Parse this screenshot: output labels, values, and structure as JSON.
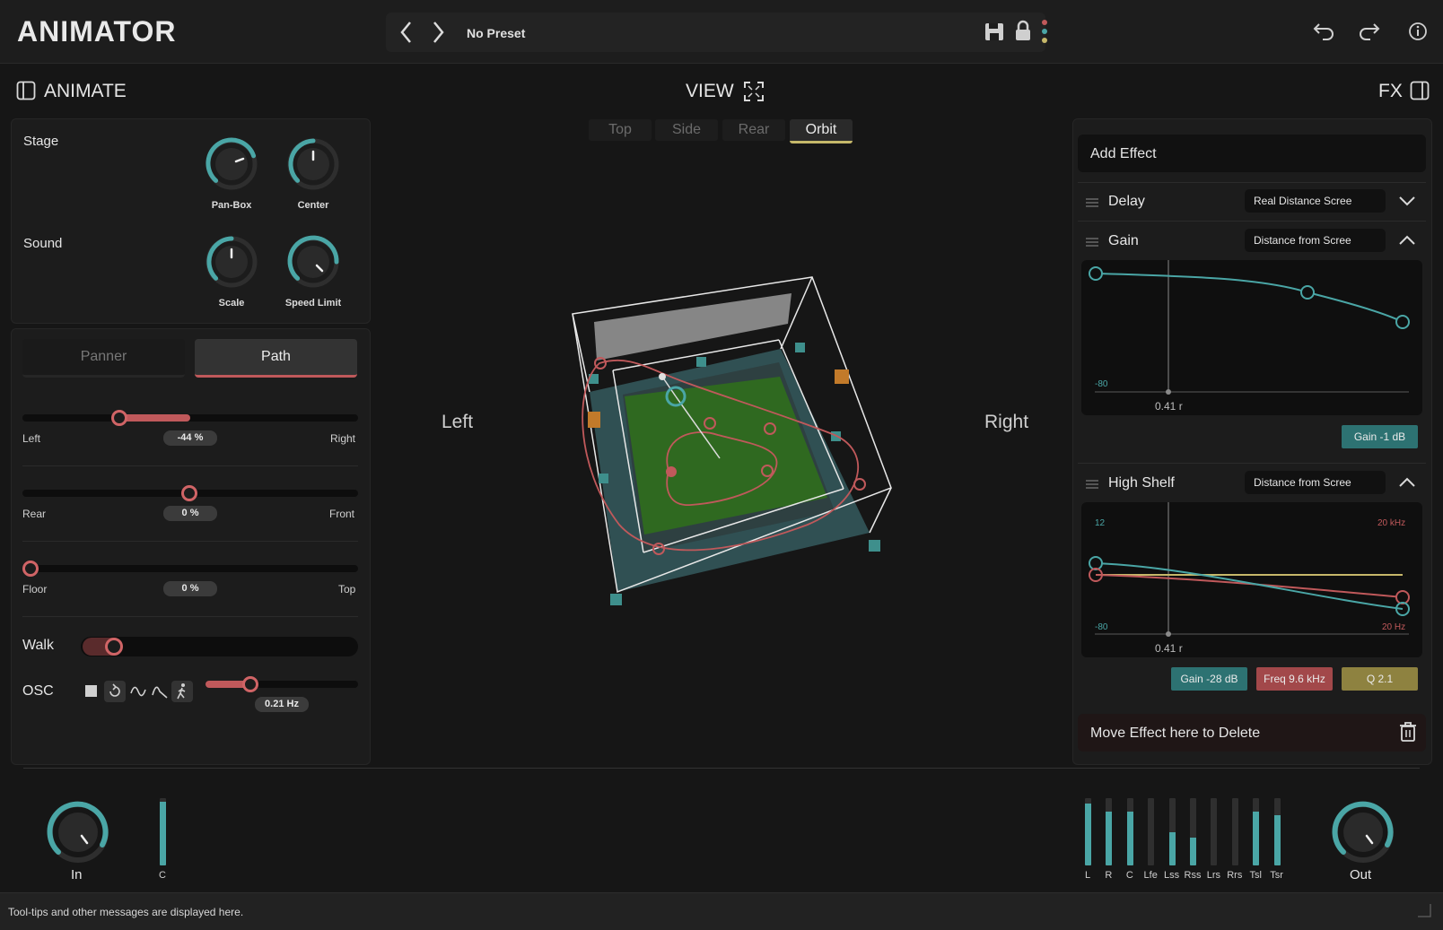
{
  "header": {
    "title": "ANIMATOR",
    "preset_name": "No Preset",
    "prev_icon": "chevron-left-icon",
    "next_icon": "chevron-right-icon"
  },
  "animate": {
    "title": "ANIMATE",
    "stage_label": "Stage",
    "sound_label": "Sound",
    "knobs": [
      {
        "label": "Pan-Box",
        "value": 0.72
      },
      {
        "label": "Center",
        "value": 0.5
      },
      {
        "label": "Scale",
        "value": 0.5
      },
      {
        "label": "Speed Limit",
        "value": 0.82
      }
    ],
    "tabs": {
      "panner": "Panner",
      "path": "Path",
      "active": "Path"
    },
    "sliders": [
      {
        "left": "Left",
        "right": "Right",
        "value_text": "-44 %",
        "value": -44
      },
      {
        "left": "Rear",
        "right": "Front",
        "value_text": "0 %",
        "value": 0
      },
      {
        "left": "Floor",
        "right": "Top",
        "value_text": "0 %",
        "value": 0
      }
    ],
    "walk_label": "Walk",
    "osc_label": "OSC",
    "osc_value": "0.21 Hz"
  },
  "view": {
    "title": "VIEW",
    "tabs": [
      "Top",
      "Side",
      "Rear",
      "Orbit"
    ],
    "active_tab": "Orbit",
    "left_label": "Left",
    "right_label": "Right"
  },
  "fx": {
    "title": "FX",
    "add_effect": "Add Effect",
    "effects": [
      {
        "name": "Delay",
        "source": "Real Distance Scree",
        "expanded": false
      },
      {
        "name": "Gain",
        "source": "Distance from Scree",
        "expanded": true
      },
      {
        "name": "High Shelf",
        "source": "Distance from Scree",
        "expanded": true
      }
    ],
    "gain_graph": {
      "min_label": "-80",
      "position_label": "0.41 r"
    },
    "gain_badge": "Gain -1 dB",
    "shelf_graph": {
      "max_label": "12",
      "min_label": "-80",
      "freq_max": "20 kHz",
      "freq_min": "20 Hz",
      "position_label": "0.41 r"
    },
    "shelf_badges": [
      "Gain -28 dB",
      "Freq 9.6 kHz",
      "Q 2.1"
    ],
    "delete_zone": "Move Effect here to Delete"
  },
  "io": {
    "in_label": "In",
    "out_label": "Out",
    "in_meters": [
      {
        "label": "C",
        "level": 0.95
      }
    ],
    "out_meters": [
      {
        "label": "L",
        "level": 0.92
      },
      {
        "label": "R",
        "level": 0.8
      },
      {
        "label": "C",
        "level": 0.8
      },
      {
        "label": "Lfe",
        "level": 0.0
      },
      {
        "label": "Lss",
        "level": 0.5
      },
      {
        "label": "Rss",
        "level": 0.42
      },
      {
        "label": "Lrs",
        "level": 0.0
      },
      {
        "label": "Rrs",
        "level": 0.0
      },
      {
        "label": "Tsl",
        "level": 0.8
      },
      {
        "label": "Tsr",
        "level": 0.75
      }
    ]
  },
  "status": {
    "message": "Tool-tips and other messages are displayed here."
  },
  "colors": {
    "teal": "#4aa6a6",
    "red": "#c0595b",
    "gold": "#c6b86a",
    "green": "#2f6b1f"
  }
}
